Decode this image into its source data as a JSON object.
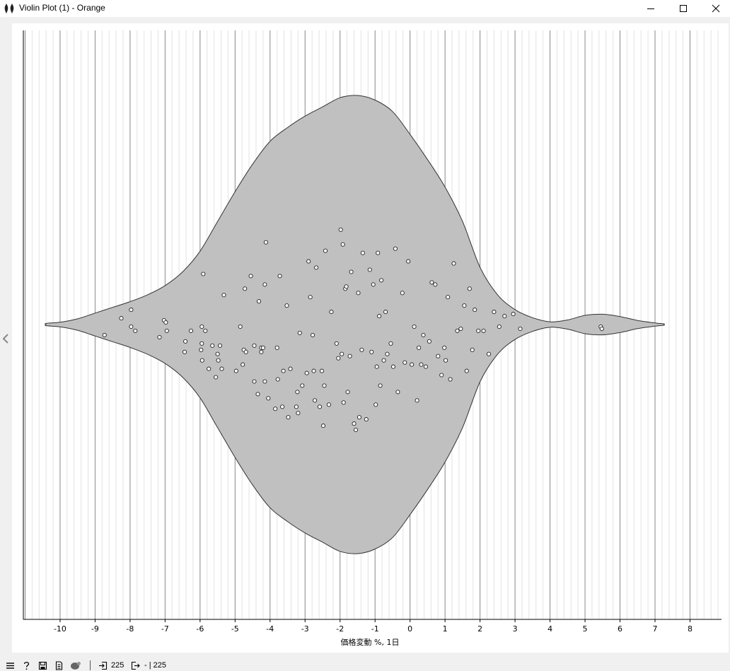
{
  "window": {
    "title": "Violin Plot (1) - Orange"
  },
  "status_bar": {
    "input_count": "225",
    "output_count": "- | 225"
  },
  "chart_data": {
    "type": "violin",
    "xlabel": "価格変動 %, 1日",
    "xlim": [
      -11.05,
      8.9
    ],
    "tick_values": [
      -10,
      -9,
      -8,
      -7,
      -6,
      -5,
      -4,
      -3,
      -2,
      -1,
      0,
      1,
      2,
      3,
      4,
      5,
      6,
      7,
      8
    ],
    "tick_labels": [
      "-10",
      "-9",
      "-8",
      "-7",
      "-6",
      "-5",
      "-4",
      "-3",
      "-2",
      "-1",
      "0",
      "1",
      "2",
      "3",
      "4",
      "5",
      "6",
      "7",
      "8"
    ],
    "grid": "vertical",
    "violin_range": [
      -10.4,
      7.25
    ],
    "density_profile": [
      [
        -10.4,
        0.005
      ],
      [
        -10.0,
        0.01
      ],
      [
        -9.5,
        0.025
      ],
      [
        -9.0,
        0.05
      ],
      [
        -8.5,
        0.075
      ],
      [
        -8.0,
        0.1
      ],
      [
        -7.5,
        0.13
      ],
      [
        -7.0,
        0.17
      ],
      [
        -6.5,
        0.23
      ],
      [
        -6.0,
        0.32
      ],
      [
        -5.5,
        0.45
      ],
      [
        -5.0,
        0.58
      ],
      [
        -4.5,
        0.7
      ],
      [
        -4.0,
        0.8
      ],
      [
        -3.5,
        0.86
      ],
      [
        -3.0,
        0.91
      ],
      [
        -2.5,
        0.95
      ],
      [
        -2.0,
        0.99
      ],
      [
        -1.5,
        1.0
      ],
      [
        -1.0,
        0.98
      ],
      [
        -0.5,
        0.93
      ],
      [
        0.0,
        0.83
      ],
      [
        0.5,
        0.72
      ],
      [
        1.0,
        0.6
      ],
      [
        1.5,
        0.45
      ],
      [
        2.0,
        0.25
      ],
      [
        2.5,
        0.13
      ],
      [
        3.0,
        0.065
      ],
      [
        3.5,
        0.03
      ],
      [
        4.0,
        0.012
      ],
      [
        4.5,
        0.02
      ],
      [
        5.0,
        0.04
      ],
      [
        5.5,
        0.045
      ],
      [
        6.0,
        0.035
      ],
      [
        6.5,
        0.018
      ],
      [
        7.0,
        0.007
      ],
      [
        7.25,
        0.003
      ]
    ],
    "points_x": [
      -8.73,
      -8.25,
      -7.97,
      -7.85,
      -7.97,
      -7.16,
      -7.03,
      -6.98,
      -6.95,
      -6.44,
      -6.42,
      -6.26,
      -5.97,
      -5.95,
      -5.85,
      -5.94,
      -5.95,
      -5.91,
      -5.75,
      -5.65,
      -5.55,
      -5.5,
      -5.48,
      -5.43,
      -5.38,
      -5.32,
      -4.97,
      -4.85,
      -4.78,
      -4.75,
      -4.72,
      -4.69,
      -4.55,
      -4.45,
      -4.45,
      -4.35,
      -4.32,
      -4.25,
      -4.25,
      -4.2,
      -4.15,
      -4.12,
      -4.15,
      -4.05,
      -3.85,
      -3.8,
      -3.78,
      -3.72,
      -3.65,
      -3.62,
      -3.52,
      -3.48,
      -3.42,
      -3.25,
      -3.22,
      -3.2,
      -3.15,
      -3.08,
      -2.95,
      -2.9,
      -2.85,
      -2.78,
      -2.75,
      -2.72,
      -2.68,
      -2.58,
      -2.52,
      -2.48,
      -2.45,
      -2.42,
      -2.32,
      -2.25,
      -2.1,
      -2.05,
      -1.98,
      -1.95,
      -1.92,
      -1.9,
      -1.85,
      -1.82,
      -1.78,
      -1.72,
      -1.68,
      -1.6,
      -1.55,
      -1.48,
      -1.45,
      -1.38,
      -1.35,
      -1.25,
      -1.15,
      -1.1,
      -1.05,
      -0.98,
      -0.95,
      -0.92,
      -0.88,
      -0.85,
      -0.82,
      -0.75,
      -0.7,
      -0.65,
      -0.55,
      -0.48,
      -0.42,
      -0.35,
      -0.22,
      -0.15,
      -0.05,
      0.05,
      0.12,
      0.2,
      0.25,
      0.32,
      0.38,
      0.45,
      0.55,
      0.62,
      0.72,
      0.8,
      0.9,
      0.98,
      1.02,
      1.08,
      1.15,
      1.25,
      1.35,
      1.45,
      1.55,
      1.62,
      1.7,
      1.78,
      1.85,
      1.95,
      2.1,
      2.25,
      2.4,
      2.55,
      2.7,
      2.95,
      3.15,
      5.45,
      5.48
    ],
    "points_jitter": [
      0.05,
      -0.03,
      0.01,
      0.03,
      -0.07,
      0.06,
      -0.02,
      -0.01,
      0.03,
      0.13,
      0.08,
      0.03,
      0.12,
      0.09,
      0.03,
      0.17,
      0.01,
      -0.24,
      0.21,
      0.1,
      0.25,
      0.14,
      0.17,
      0.1,
      0.21,
      -0.14,
      0.22,
      0.01,
      0.19,
      0.12,
      -0.17,
      0.13,
      -0.23,
      0.1,
      0.27,
      0.33,
      -0.11,
      0.11,
      0.13,
      0.11,
      -0.19,
      -0.39,
      0.27,
      0.35,
      0.4,
      0.11,
      0.26,
      -0.23,
      0.39,
      0.22,
      -0.09,
      0.44,
      0.21,
      0.39,
      0.32,
      0.42,
      0.04,
      0.29,
      0.23,
      -0.3,
      -0.13,
      0.05,
      0.22,
      0.36,
      -0.27,
      0.39,
      0.22,
      0.48,
      0.29,
      -0.35,
      0.38,
      -0.06,
      0.09,
      0.16,
      -0.45,
      0.14,
      -0.38,
      0.37,
      -0.17,
      -0.18,
      0.32,
      0.15,
      -0.25,
      0.47,
      0.5,
      -0.15,
      0.44,
      0.12,
      -0.34,
      0.45,
      -0.26,
      0.13,
      -0.19,
      0.38,
      0.2,
      -0.34,
      -0.04,
      0.29,
      -0.21,
      0.17,
      -0.06,
      0.14,
      0.09,
      0.2,
      -0.36,
      0.32,
      -0.15,
      0.18,
      -0.3,
      0.19,
      0.01,
      0.36,
      0.11,
      0.19,
      0.05,
      0.2,
      0.08,
      -0.2,
      -0.19,
      0.15,
      0.24,
      0.11,
      0.17,
      -0.13,
      0.26,
      -0.29,
      0.03,
      0.02,
      -0.09,
      0.22,
      -0.17,
      0.12,
      -0.07,
      0.03,
      0.03,
      0.14,
      -0.06,
      0.01,
      -0.04,
      -0.05,
      0.02,
      0.01,
      0.02
    ]
  }
}
